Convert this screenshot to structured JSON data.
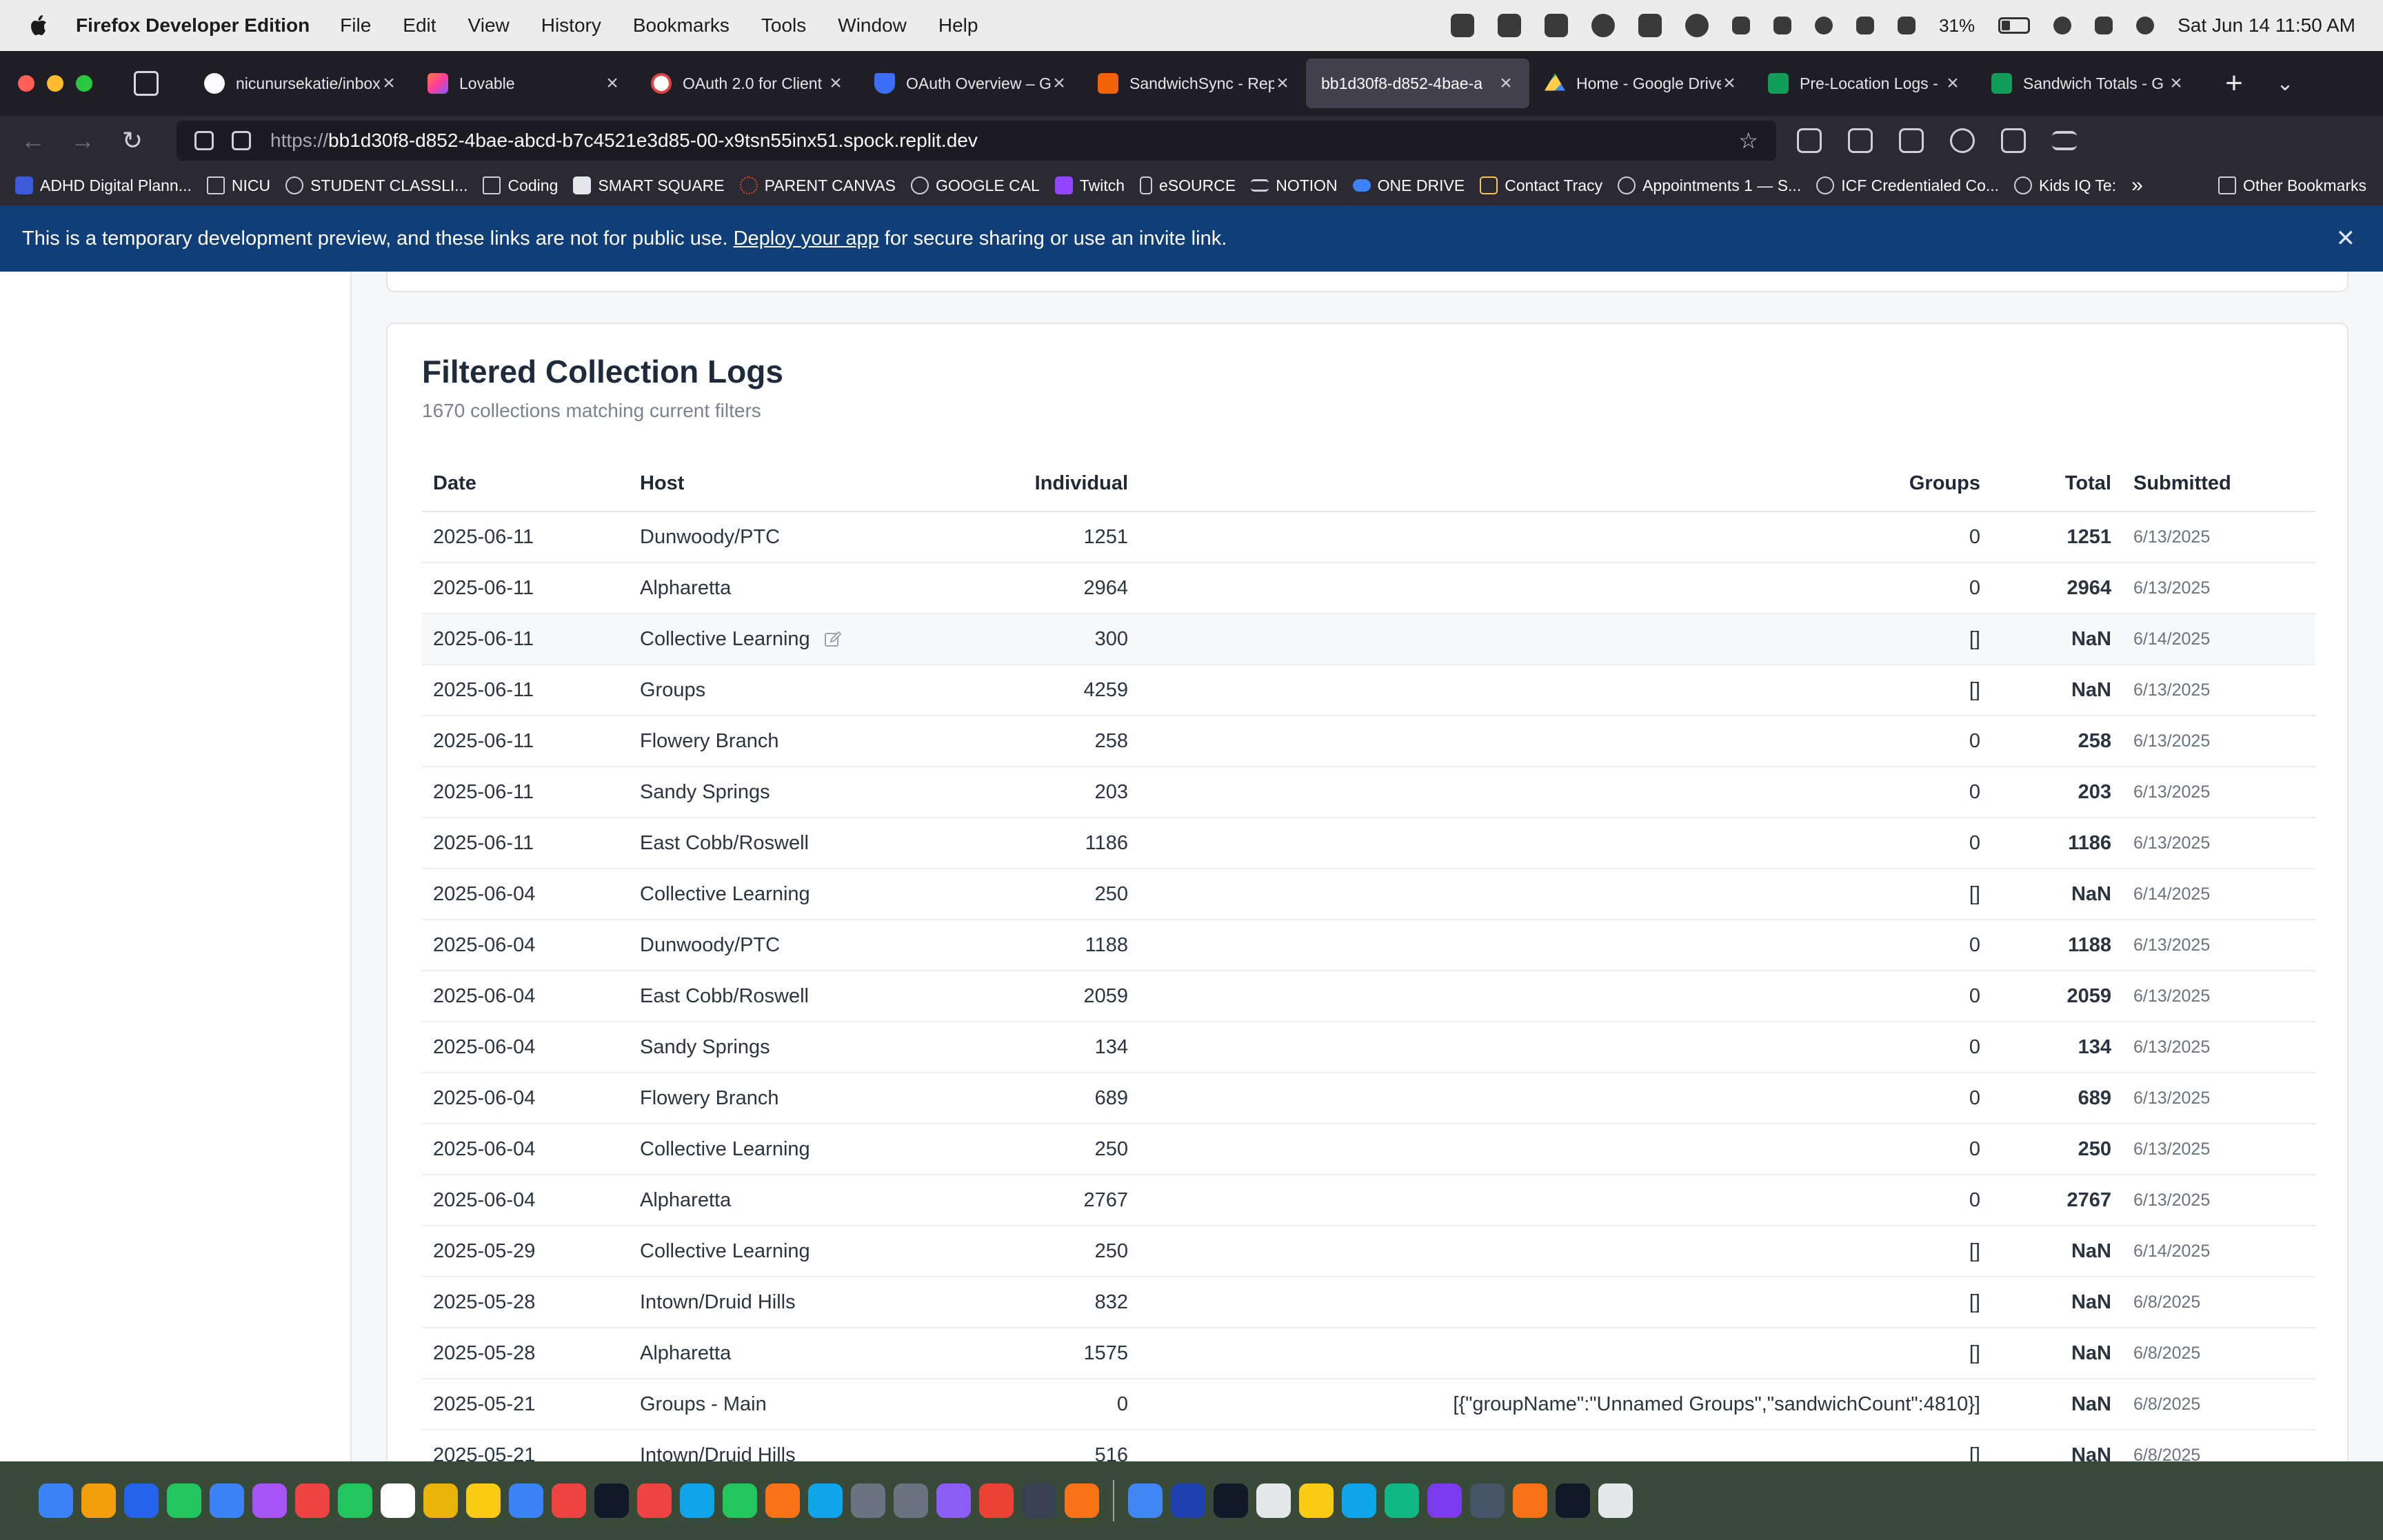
{
  "menubar": {
    "app_name": "Firefox Developer Edition",
    "items": [
      "File",
      "Edit",
      "View",
      "History",
      "Bookmarks",
      "Tools",
      "Window",
      "Help"
    ],
    "battery": "31%",
    "clock": "Sat Jun 14  11:50 AM"
  },
  "tabs": [
    {
      "title": "nicunursekatie/inbox",
      "color": "#fbfbfe"
    },
    {
      "title": "Lovable",
      "color": "#ff4f7a"
    },
    {
      "title": "OAuth 2.0 for Client",
      "color": "#ffffff"
    },
    {
      "title": "OAuth Overview – G",
      "color": "#3b6df6"
    },
    {
      "title": "SandwichSync - Rep",
      "color": "#f26207"
    },
    {
      "title": "bb1d30f8-d852-4bae-a",
      "color": "#42414d"
    },
    {
      "title": "Home - Google Drive",
      "color": "#1fa463"
    },
    {
      "title": "Pre-Location Logs -",
      "color": "#0f9d58"
    },
    {
      "title": "Sandwich Totals - G",
      "color": "#0f9d58"
    }
  ],
  "url": {
    "prefix": "https://",
    "host": "bb1d30f8-d852-4bae-abcd-b7c4521e3d85-00-x9tsn55inx51.spock.replit.dev"
  },
  "bookmarks": [
    "ADHD Digital Plann...",
    "NICU",
    "STUDENT CLASSLI...",
    "Coding",
    "SMART SQUARE",
    "PARENT CANVAS",
    "GOOGLE CAL",
    "Twitch",
    "eSOURCE",
    "NOTION",
    "ONE DRIVE",
    "Contact Tracy",
    "Appointments 1 — S...",
    "ICF Credentialed Co...",
    "Kids IQ Te:"
  ],
  "bookmarks_other": "Other Bookmarks",
  "banner": {
    "text_before": "This is a temporary development preview, and these links are not for public use.",
    "link": "Deploy your app",
    "text_after": "for secure sharing or use an invite link."
  },
  "logs": {
    "title": "Filtered Collection Logs",
    "subtitle": "1670 collections matching current filters",
    "columns": {
      "date": "Date",
      "host": "Host",
      "individual": "Individual",
      "groups": "Groups",
      "total": "Total",
      "submitted": "Submitted"
    },
    "rows": [
      {
        "date": "2025-06-11",
        "host": "Dunwoody/PTC",
        "individual": "1251",
        "groups": "0",
        "total": "1251",
        "submitted": "6/13/2025"
      },
      {
        "date": "2025-06-11",
        "host": "Alpharetta",
        "individual": "2964",
        "groups": "0",
        "total": "2964",
        "submitted": "6/13/2025"
      },
      {
        "date": "2025-06-11",
        "host": "Collective Learning",
        "individual": "300",
        "groups": "[]",
        "total": "NaN",
        "submitted": "6/14/2025"
      },
      {
        "date": "2025-06-11",
        "host": "Groups",
        "individual": "4259",
        "groups": "[]",
        "total": "NaN",
        "submitted": "6/13/2025"
      },
      {
        "date": "2025-06-11",
        "host": "Flowery Branch",
        "individual": "258",
        "groups": "0",
        "total": "258",
        "submitted": "6/13/2025"
      },
      {
        "date": "2025-06-11",
        "host": "Sandy Springs",
        "individual": "203",
        "groups": "0",
        "total": "203",
        "submitted": "6/13/2025"
      },
      {
        "date": "2025-06-11",
        "host": "East Cobb/Roswell",
        "individual": "1186",
        "groups": "0",
        "total": "1186",
        "submitted": "6/13/2025"
      },
      {
        "date": "2025-06-04",
        "host": "Collective Learning",
        "individual": "250",
        "groups": "[]",
        "total": "NaN",
        "submitted": "6/14/2025"
      },
      {
        "date": "2025-06-04",
        "host": "Dunwoody/PTC",
        "individual": "1188",
        "groups": "0",
        "total": "1188",
        "submitted": "6/13/2025"
      },
      {
        "date": "2025-06-04",
        "host": "East Cobb/Roswell",
        "individual": "2059",
        "groups": "0",
        "total": "2059",
        "submitted": "6/13/2025"
      },
      {
        "date": "2025-06-04",
        "host": "Sandy Springs",
        "individual": "134",
        "groups": "0",
        "total": "134",
        "submitted": "6/13/2025"
      },
      {
        "date": "2025-06-04",
        "host": "Flowery Branch",
        "individual": "689",
        "groups": "0",
        "total": "689",
        "submitted": "6/13/2025"
      },
      {
        "date": "2025-06-04",
        "host": "Collective Learning",
        "individual": "250",
        "groups": "0",
        "total": "250",
        "submitted": "6/13/2025"
      },
      {
        "date": "2025-06-04",
        "host": "Alpharetta",
        "individual": "2767",
        "groups": "0",
        "total": "2767",
        "submitted": "6/13/2025"
      },
      {
        "date": "2025-05-29",
        "host": "Collective Learning",
        "individual": "250",
        "groups": "[]",
        "total": "NaN",
        "submitted": "6/14/2025"
      },
      {
        "date": "2025-05-28",
        "host": "Intown/Druid Hills",
        "individual": "832",
        "groups": "[]",
        "total": "NaN",
        "submitted": "6/8/2025"
      },
      {
        "date": "2025-05-28",
        "host": "Alpharetta",
        "individual": "1575",
        "groups": "[]",
        "total": "NaN",
        "submitted": "6/8/2025"
      },
      {
        "date": "2025-05-21",
        "host": "Groups - Main",
        "individual": "0",
        "groups": "[{\"groupName\":\"Unnamed Groups\",\"sandwichCount\":4810}]",
        "total": "NaN",
        "submitted": "6/8/2025"
      },
      {
        "date": "2025-05-21",
        "host": "Intown/Druid Hills",
        "individual": "516",
        "groups": "[]",
        "total": "NaN",
        "submitted": "6/8/2025"
      }
    ]
  },
  "dock_colors": [
    "#3b82f6",
    "#f59e0b",
    "#2563eb",
    "#22c55e",
    "#3b82f6",
    "#a855f7",
    "#ef4444",
    "#22c55e",
    "#ffffff",
    "#eab308",
    "#facc15",
    "#3b82f6",
    "#ef4444",
    "#111827",
    "#ef4444",
    "#0ea5e9",
    "#22c55e",
    "#f97316",
    "#0ea5e9",
    "#6b7280",
    "#6b7280",
    "#8b5cf6",
    "#ea4335",
    "#374151",
    "#f97316",
    "#4285f4",
    "#1e40af",
    "#111827",
    "#e5e7eb",
    "#facc15",
    "#0ea5e9",
    "#10b981",
    "#7c3aed",
    "#475569",
    "#f97316",
    "#111827",
    "#e5e7eb"
  ]
}
